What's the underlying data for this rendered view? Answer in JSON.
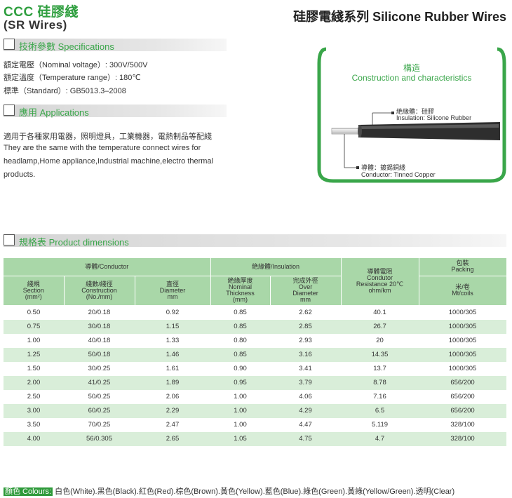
{
  "header": {
    "ccc_title": "CCC 硅膠綫",
    "sr_title": "(SR Wires)",
    "series_title": "硅膠電綫系列 Silicone Rubber Wires"
  },
  "specifications": {
    "section_label": "技術參數 Specifications",
    "lines": [
      "額定電壓（Nominal voltage）: 300V/500V",
      "額定溫度（Temperature range）: 180℃",
      "標準（Standard）: GB5013.3–2008"
    ]
  },
  "applications": {
    "section_label": "應用 Applications",
    "lines": [
      "適用于各種家用電器，照明燈具，工業機器，電熱制品等配綫",
      "They are the same with the temperature connect wires for",
      "headlamp,Home appliance,Industrial machine,electro thermal",
      "products."
    ]
  },
  "construction": {
    "title_cn": "構造",
    "title_en": "Construction and characteristics",
    "insulation_cn": "絶緣體：硅膠",
    "insulation_en": "Insulation: Silicone Rubber",
    "conductor_cn": "導體：鍍錫銅綫",
    "conductor_en": "Conductor: Tinned Copper"
  },
  "dimensions": {
    "section_label": "規格表 Product dimensions",
    "group_headers": {
      "conductor": "導體/Conductor",
      "insulation": "絶緣體/Insulation",
      "resistance": [
        "導體電阻",
        "Condutor",
        "Resistance 20℃",
        "ohm/km"
      ],
      "packing": [
        "包裝",
        "Packing"
      ]
    },
    "columns": {
      "section": [
        "綫規",
        "Section",
        "(mm²)"
      ],
      "construction": [
        "綫數/綫徑",
        "Construction",
        "(No./mm)"
      ],
      "diameter": [
        "直徑",
        "Diameter",
        "mm"
      ],
      "thickness": [
        "絶緣厚度",
        "Nominal",
        "Thickness",
        "(mm)"
      ],
      "overall": [
        "完成外徑",
        "Over",
        "Diameter",
        "mm"
      ],
      "packing_unit": [
        "米/卷",
        "Mt/coils"
      ]
    },
    "rows": [
      [
        "0.50",
        "20/0.18",
        "0.92",
        "0.85",
        "2.62",
        "40.1",
        "1000/305"
      ],
      [
        "0.75",
        "30/0.18",
        "1.15",
        "0.85",
        "2.85",
        "26.7",
        "1000/305"
      ],
      [
        "1.00",
        "40/0.18",
        "1.33",
        "0.80",
        "2.93",
        "20",
        "1000/305"
      ],
      [
        "1.25",
        "50/0.18",
        "1.46",
        "0.85",
        "3.16",
        "14.35",
        "1000/305"
      ],
      [
        "1.50",
        "30/0.25",
        "1.61",
        "0.90",
        "3.41",
        "13.7",
        "1000/305"
      ],
      [
        "2.00",
        "41/0.25",
        "1.89",
        "0.95",
        "3.79",
        "8.78",
        "656/200"
      ],
      [
        "2.50",
        "50/0.25",
        "2.06",
        "1.00",
        "4.06",
        "7.16",
        "656/200"
      ],
      [
        "3.00",
        "60/0.25",
        "2.29",
        "1.00",
        "4.29",
        "6.5",
        "656/200"
      ],
      [
        "3.50",
        "70/0.25",
        "2.47",
        "1.00",
        "4.47",
        "5.119",
        "328/100"
      ],
      [
        "4.00",
        "56/0.305",
        "2.65",
        "1.05",
        "4.75",
        "4.7",
        "328/100"
      ]
    ]
  },
  "colours": {
    "label": "顏色 Colours:",
    "list": " 白色(White).黑色(Black).紅色(Red).棕色(Brown).黃色(Yellow).藍色(Blue).綠色(Green).黃綠(Yellow/Green).透明(Clear)"
  },
  "theme": {
    "accent": "#3aa64a",
    "header_green": "#a9d7a8",
    "row_alt": "#d9eed9"
  }
}
